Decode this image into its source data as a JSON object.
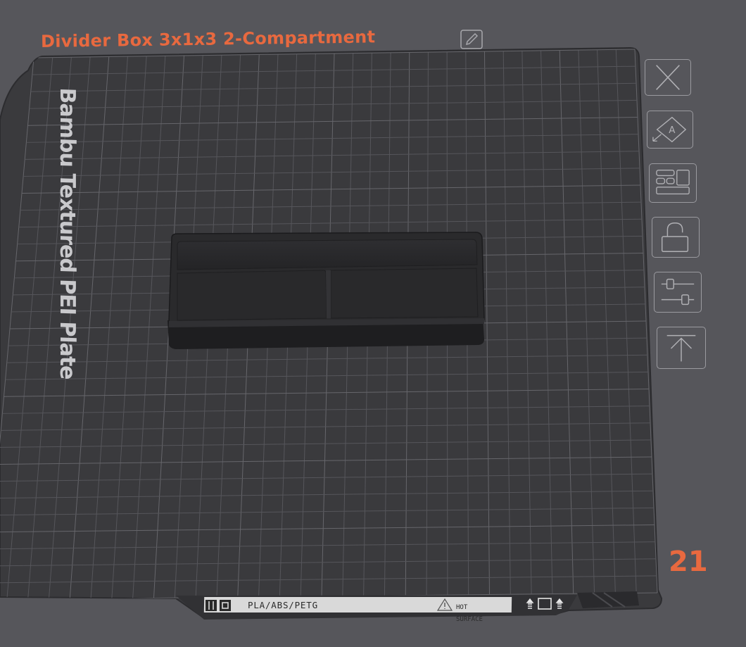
{
  "plate": {
    "name": "Divider Box 3x1x3 2-Compartment",
    "type_label": "Bambu Textured PEI Plate",
    "number": "21",
    "label_strip": {
      "filaments": "PLA/ABS/PETG",
      "warning_line1": "HOT",
      "warning_line2": "SURFACE"
    }
  },
  "toolbar": {
    "close": "close",
    "auto_orient": "auto orient",
    "arrange": "arrange",
    "lock": "lock",
    "settings": "plate settings",
    "move_to_top": "move to top"
  },
  "icons": {
    "edit": "pencil-icon",
    "close": "close-icon",
    "auto_orient": "auto-orient-icon",
    "arrange": "arrange-icon",
    "lock": "unlock-icon",
    "settings": "sliders-icon",
    "move_top": "arrow-up-icon",
    "warning": "warning-triangle-icon"
  },
  "colors": {
    "accent": "#e8693f",
    "background": "#56565b",
    "plate": "#3a3a3d",
    "grid": "#5a5a5f",
    "model": "#262628",
    "label_text": "#c8c8c8"
  }
}
